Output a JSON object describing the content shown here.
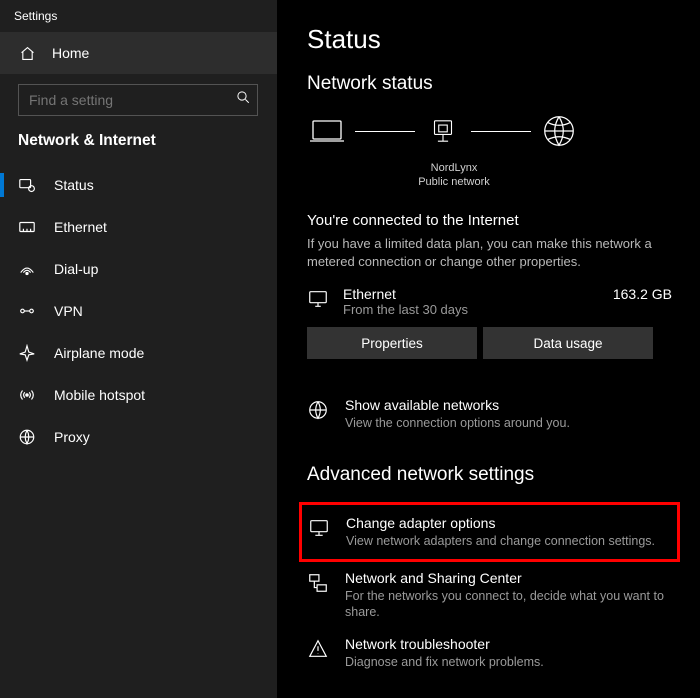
{
  "app_title": "Settings",
  "home_label": "Home",
  "search_placeholder": "Find a setting",
  "category": "Network & Internet",
  "nav": [
    {
      "label": "Status"
    },
    {
      "label": "Ethernet"
    },
    {
      "label": "Dial-up"
    },
    {
      "label": "VPN"
    },
    {
      "label": "Airplane mode"
    },
    {
      "label": "Mobile hotspot"
    },
    {
      "label": "Proxy"
    }
  ],
  "page_title": "Status",
  "network_status_heading": "Network status",
  "diagram": {
    "adapter_name": "NordLynx",
    "network_type": "Public network"
  },
  "connected": {
    "title": "You're connected to the Internet",
    "desc": "If you have a limited data plan, you can make this network a metered connection or change other properties."
  },
  "usage": {
    "adapter": "Ethernet",
    "period": "From the last 30 days",
    "amount": "163.2 GB"
  },
  "buttons": {
    "properties": "Properties",
    "data_usage": "Data usage"
  },
  "show_networks": {
    "title": "Show available networks",
    "desc": "View the connection options around you."
  },
  "advanced_heading": "Advanced network settings",
  "adapter_options": {
    "title": "Change adapter options",
    "desc": "View network adapters and change connection settings."
  },
  "sharing_center": {
    "title": "Network and Sharing Center",
    "desc": "For the networks you connect to, decide what you want to share."
  },
  "troubleshooter": {
    "title": "Network troubleshooter",
    "desc": "Diagnose and fix network problems."
  }
}
